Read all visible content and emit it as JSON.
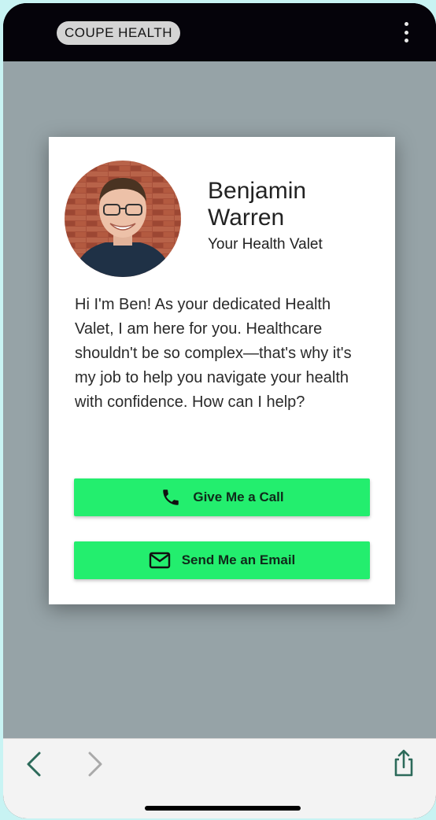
{
  "header": {
    "brand": "COUPE HEALTH",
    "menu_icon": "more-vertical-icon"
  },
  "profile": {
    "name": "Benjamin Warren",
    "title": "Your Health Valet",
    "photo": "avatar-photo",
    "bio": "Hi I'm Ben! As your dedicated Health Valet, I am here for you. Healthcare shouldn't be so complex—that's why it's my job to help you navigate your health with confidence. How can I help?"
  },
  "actions": {
    "call": {
      "label": "Give Me a Call",
      "icon": "phone-icon"
    },
    "email": {
      "label": "Send Me an Email",
      "icon": "mail-icon"
    }
  },
  "browser": {
    "back_icon": "chevron-left-icon",
    "forward_icon": "chevron-right-icon",
    "share_icon": "share-icon"
  },
  "colors": {
    "accent": "#23ee6e",
    "overlay": "#96a3a7",
    "topbar": "#05030a",
    "nav_active": "#2c6a5a"
  }
}
